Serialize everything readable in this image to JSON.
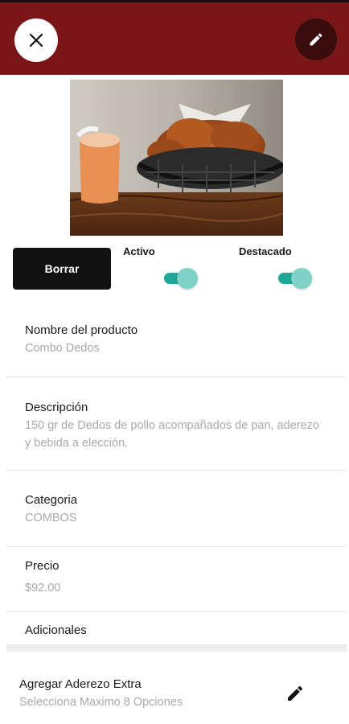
{
  "header": {
    "close_icon": "close-icon",
    "edit_icon": "pencil-icon",
    "bar_color": "#7a1618"
  },
  "product_image": {
    "description_icon": "food-photo"
  },
  "actions": {
    "delete_label": "Borrar",
    "active_label": "Activo",
    "active_on": true,
    "featured_label": "Destacado",
    "featured_on": true,
    "toggle_color": "#1ea898"
  },
  "fields": {
    "name": {
      "label": "Nombre del producto",
      "value": "Combo Dedos"
    },
    "description": {
      "label": "Descripción",
      "value": "150 gr de Dedos de pollo acompañados de pan, aderezo y bebida a elección."
    },
    "category": {
      "label": "Categoria",
      "value": "COMBOS"
    },
    "price": {
      "label": "Precio",
      "value": "$92.00"
    },
    "extras": {
      "label": "Adicionales"
    }
  },
  "extras_list": [
    {
      "title": "Agregar Aderezo Extra",
      "subtitle": "Selecciona Maximo 8 Opciones",
      "icon": "pencil-icon"
    }
  ]
}
